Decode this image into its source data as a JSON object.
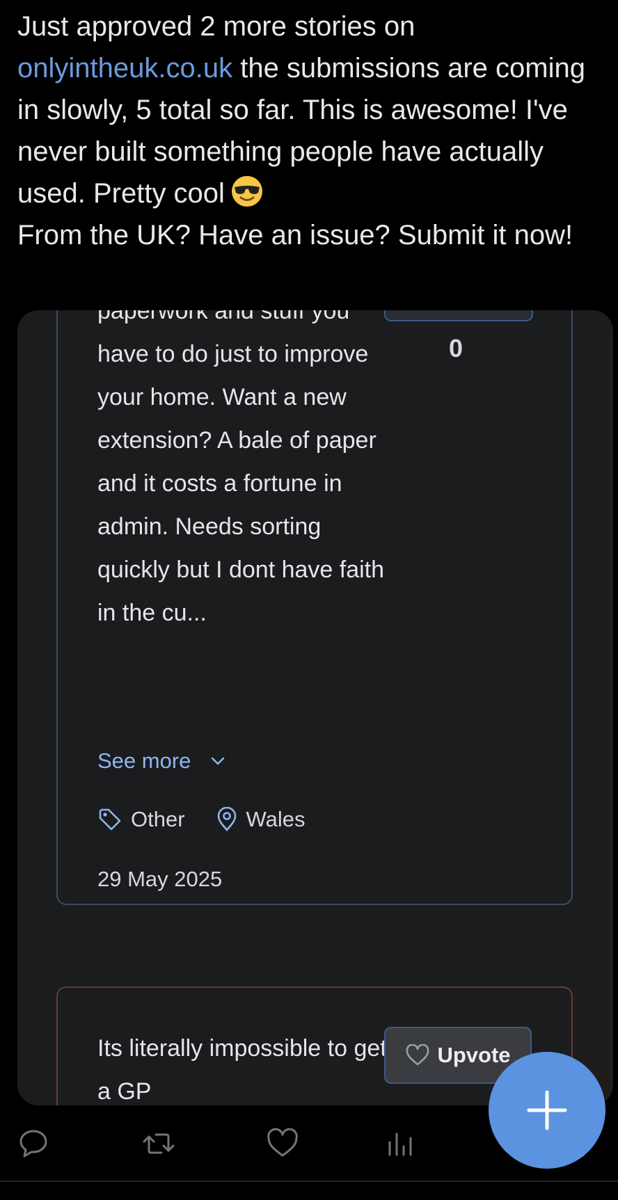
{
  "tweet": {
    "text_before_link": "Just approved 2 more stories on ",
    "link": "onlyintheuk.co.uk",
    "text_after_link": " the submissions are coming in slowly, 5 total so far. This is awesome! I've never built something people have actually used. Pretty cool",
    "emoji": "smiling-face-with-sunglasses",
    "line_after_emoji": "From the UK? Have an issue? Submit it now!"
  },
  "card1": {
    "story_excerpt": "paperwork and stuff you have to do just to improve your home. Want a new extension? A bale of paper and it costs a fortune in admin. Needs sorting quickly but I dont have faith in the cu...",
    "vote_count": "0",
    "see_more_label": "See more",
    "category": "Other",
    "location": "Wales",
    "date": "29 May 2025"
  },
  "card2": {
    "story_excerpt": "Its literally impossible to get a GP",
    "upvote_label": "Upvote"
  },
  "actions": [
    "reply-icon",
    "retweet-icon",
    "like-icon",
    "views-icon",
    "share-icon"
  ],
  "fab_icon": "plus-icon",
  "colors": {
    "link": "#6a9bdc",
    "fab": "#5b93e0",
    "card_border": "#3c4a63",
    "accent_text": "#8fb6ef"
  }
}
